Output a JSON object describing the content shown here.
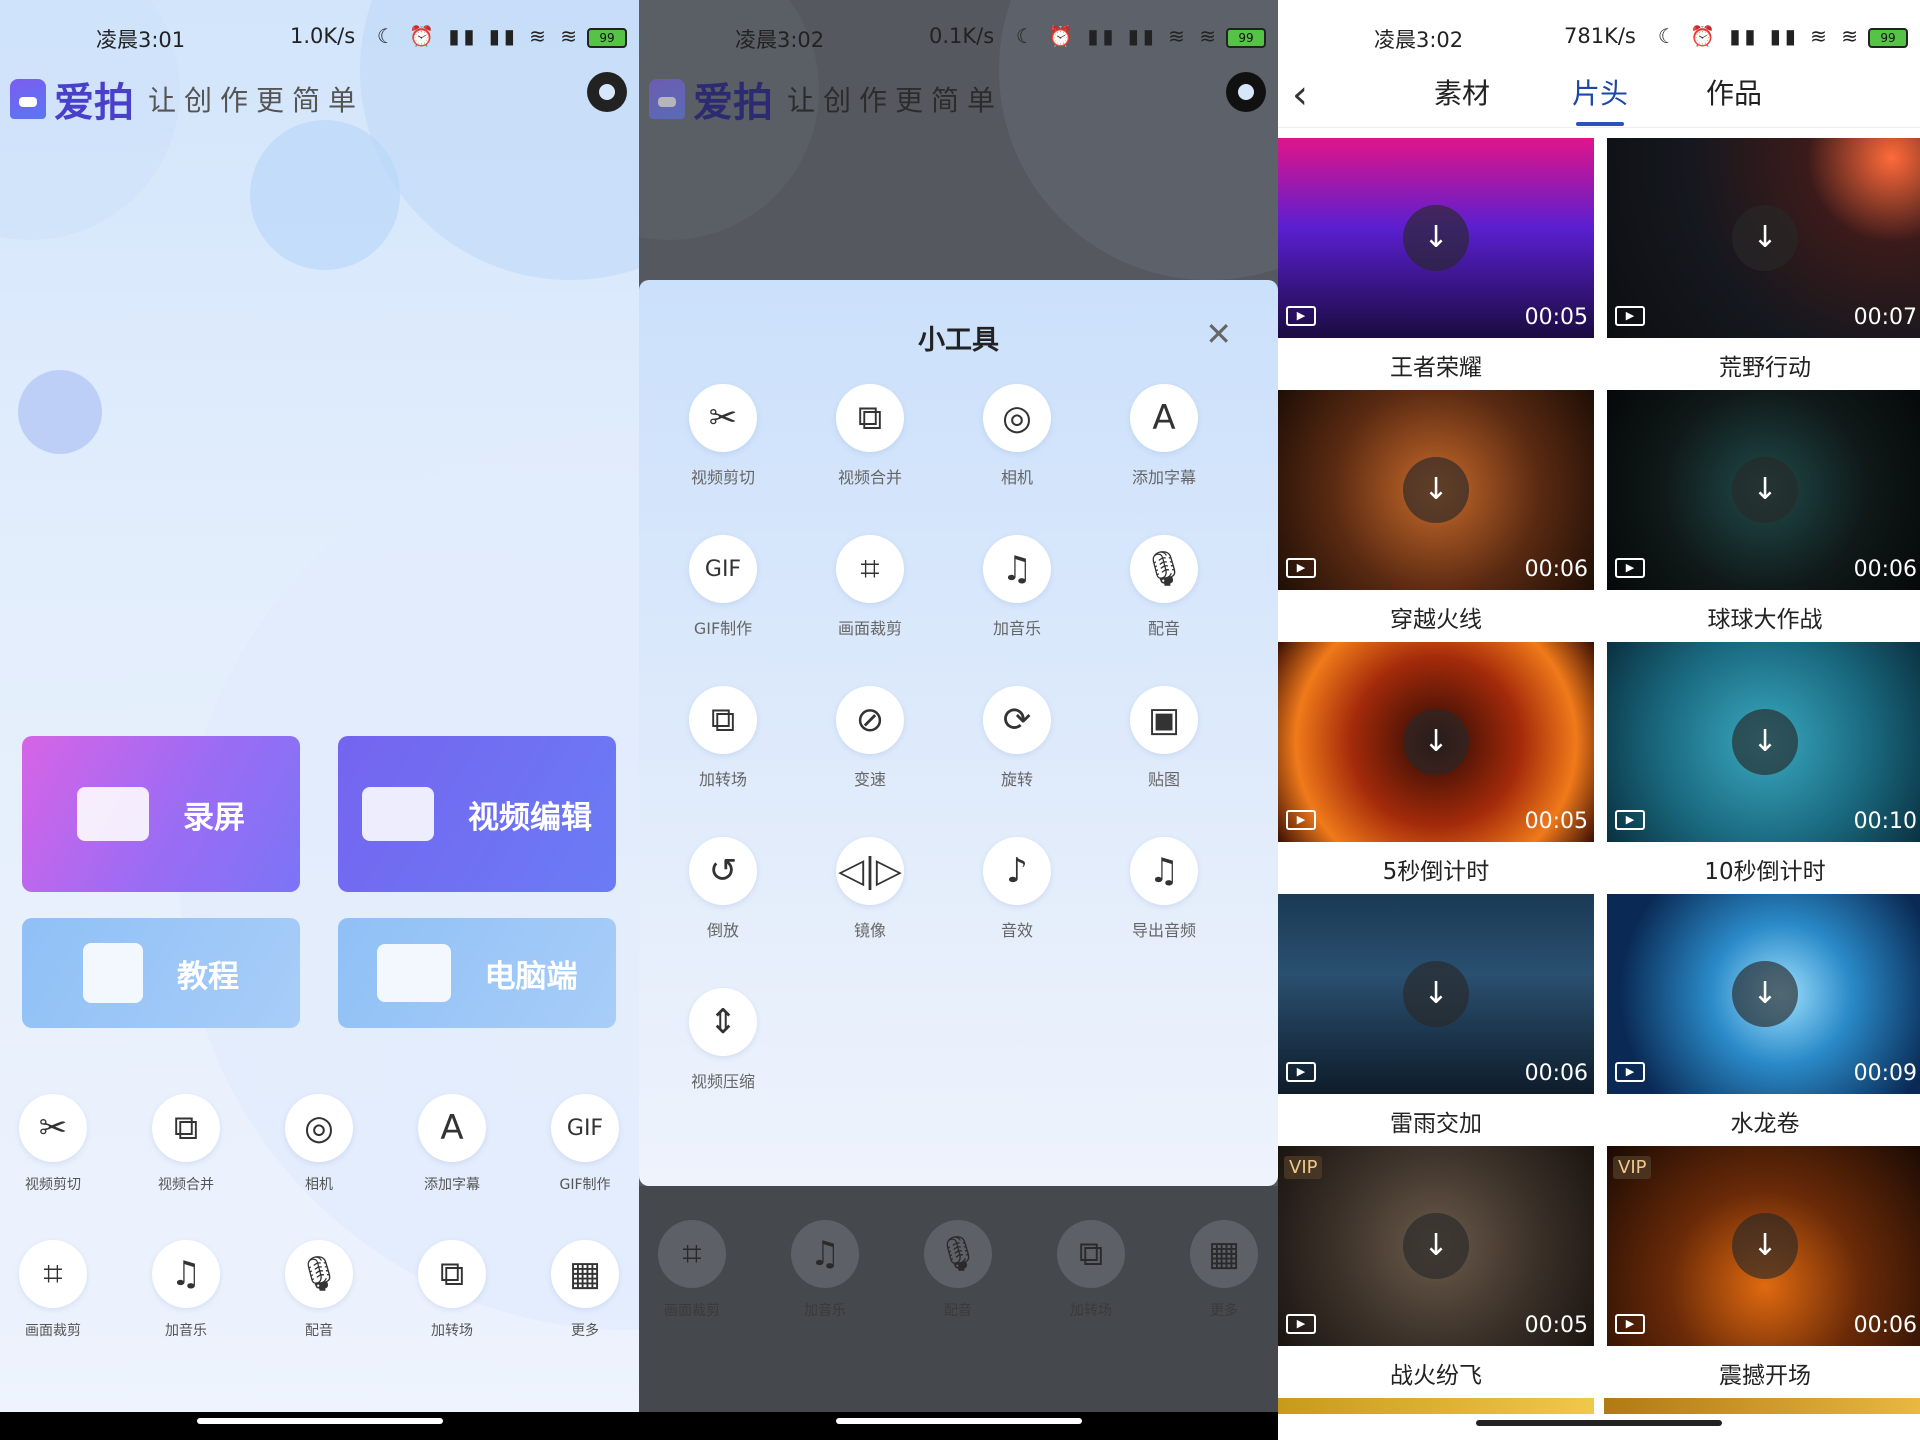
{
  "p1": {
    "status": {
      "time": "凌晨3:01",
      "speed": "1.0K/s",
      "battery": "99"
    },
    "brand": "爱拍",
    "slogan": "让创作更简单",
    "cards": [
      {
        "label": "录屏"
      },
      {
        "label": "视频编辑"
      },
      {
        "label": "教程"
      },
      {
        "label": "电脑端"
      }
    ],
    "tools": [
      {
        "label": "视频剪切",
        "icon": "✂"
      },
      {
        "label": "视频合并",
        "icon": "⧉"
      },
      {
        "label": "相机",
        "icon": "◎"
      },
      {
        "label": "添加字幕",
        "icon": "A"
      },
      {
        "label": "GIF制作",
        "icon": "GIF"
      },
      {
        "label": "画面裁剪",
        "icon": "⌗"
      },
      {
        "label": "加音乐",
        "icon": "♫"
      },
      {
        "label": "配音",
        "icon": "🎙"
      },
      {
        "label": "加转场",
        "icon": "⧉"
      },
      {
        "label": "更多",
        "icon": "▦"
      }
    ]
  },
  "p2": {
    "status": {
      "time": "凌晨3:02",
      "speed": "0.1K/s",
      "battery": "99"
    },
    "brand": "爱拍",
    "slogan": "让创作更简单",
    "sheet": {
      "title": "小工具",
      "tools": [
        {
          "label": "视频剪切",
          "icon": "✂"
        },
        {
          "label": "视频合并",
          "icon": "⧉"
        },
        {
          "label": "相机",
          "icon": "◎"
        },
        {
          "label": "添加字幕",
          "icon": "A"
        },
        {
          "label": "GIF制作",
          "icon": "GIF"
        },
        {
          "label": "画面裁剪",
          "icon": "⌗"
        },
        {
          "label": "加音乐",
          "icon": "♫"
        },
        {
          "label": "配音",
          "icon": "🎙"
        },
        {
          "label": "加转场",
          "icon": "⧉"
        },
        {
          "label": "变速",
          "icon": "⊘"
        },
        {
          "label": "旋转",
          "icon": "⟳"
        },
        {
          "label": "贴图",
          "icon": "▣"
        },
        {
          "label": "倒放",
          "icon": "↺"
        },
        {
          "label": "镜像",
          "icon": "◁|▷"
        },
        {
          "label": "音效",
          "icon": "♪"
        },
        {
          "label": "导出音频",
          "icon": "♫"
        },
        {
          "label": "视频压缩",
          "icon": "⇕"
        }
      ]
    },
    "bottom_tools": [
      {
        "label": "画面裁剪",
        "icon": "⌗"
      },
      {
        "label": "加音乐",
        "icon": "♫"
      },
      {
        "label": "配音",
        "icon": "🎙"
      },
      {
        "label": "加转场",
        "icon": "⧉"
      },
      {
        "label": "更多",
        "icon": "▦"
      }
    ]
  },
  "p3": {
    "status": {
      "time": "凌晨3:02",
      "speed": "781K/s",
      "battery": "99"
    },
    "tabs": [
      "素材",
      "片头",
      "作品"
    ],
    "active_tab": "片头",
    "videos": [
      {
        "name": "王者荣耀",
        "duration": "00:05",
        "bg": "linear-gradient(180deg,#e0148a 0%,#5a1fd0 45%,#1a0b40 100%)",
        "vip": ""
      },
      {
        "name": "荒野行动",
        "duration": "00:07",
        "bg": "radial-gradient(circle at 90% 10%,#ff6a3a 0%,#3b1a1a 25%,#15181e 60%,#0c0e12 100%)",
        "vip": ""
      },
      {
        "name": "穿越火线",
        "duration": "00:06",
        "bg": "radial-gradient(circle,#c86a2a 0%,#5a2a12 55%,#1e0e06 100%)",
        "vip": ""
      },
      {
        "name": "球球大作战",
        "duration": "00:06",
        "bg": "radial-gradient(circle,#1f4a4a 0%,#101818 55%,#050808 100%)",
        "vip": ""
      },
      {
        "name": "5秒倒计时",
        "duration": "00:05",
        "bg": "radial-gradient(circle,#2a0a04 0%,#a32a0a 45%,#f07a1a 75%,#3a0e04 100%)",
        "vip": ""
      },
      {
        "name": "10秒倒计时",
        "duration": "00:10",
        "bg": "radial-gradient(circle,#3aa8c0 0%,#1a6a80 55%,#0a3040 100%)",
        "vip": ""
      },
      {
        "name": "雷雨交加",
        "duration": "00:06",
        "bg": "linear-gradient(180deg,#1a3a55 0%,#2a5070 40%,#0e1c2a 100%)",
        "vip": ""
      },
      {
        "name": "水龙卷",
        "duration": "00:09",
        "bg": "radial-gradient(circle at 55% 50%,#9fe0ff 0%,#2a8ac8 35%,#0a2a55 80%)",
        "vip": ""
      },
      {
        "name": "战火纷飞",
        "duration": "00:05",
        "bg": "radial-gradient(circle,#6a5a4a 0%,#3a3028 55%,#1a1410 100%)",
        "vip": "VIP"
      },
      {
        "name": "震撼开场",
        "duration": "00:06",
        "bg": "radial-gradient(circle at 50% 70%,#e06a10 0%,#6a2a08 45%,#1a0a04 100%)",
        "vip": "VIP"
      }
    ]
  }
}
